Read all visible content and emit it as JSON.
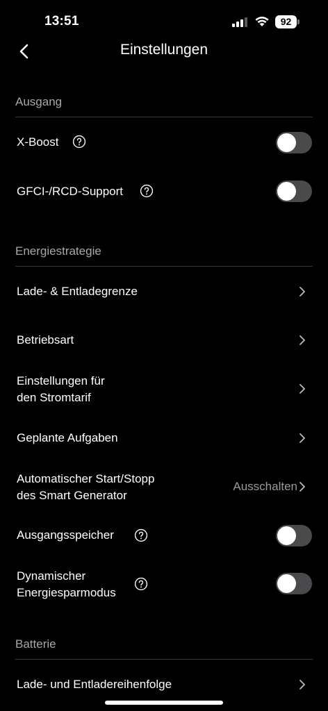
{
  "status_bar": {
    "time": "13:51",
    "battery": "92"
  },
  "header": {
    "title": "Einstellungen"
  },
  "sections": {
    "ausgang": {
      "title": "Ausgang",
      "x_boost": {
        "label": "X-Boost",
        "enabled": false
      },
      "gfci": {
        "label": "GFCI-/RCD-Support",
        "enabled": false
      }
    },
    "energie": {
      "title": "Energiestrategie",
      "lade_grenze": {
        "label": "Lade- & Entladegrenze"
      },
      "betriebsart": {
        "label": "Betriebsart"
      },
      "stromtarif": {
        "label_line1": "Einstellungen für",
        "label_line2": "den Stromtarif"
      },
      "geplante": {
        "label": "Geplante Aufgaben"
      },
      "generator": {
        "label_line1": "Automatischer Start/Stopp",
        "label_line2": "des Smart Generator",
        "value": "Ausschalten"
      },
      "ausgangsspeicher": {
        "label": "Ausgangsspeicher",
        "enabled": false
      },
      "sparmodus": {
        "label_line1": "Dynamischer",
        "label_line2": "Energiesparmodus",
        "enabled": false
      }
    },
    "batterie": {
      "title": "Batterie",
      "reihenfolge": {
        "label": "Lade- und Entladereihenfolge"
      }
    }
  },
  "colors": {
    "background": "#000000",
    "section_title": "#a8a8a8",
    "toggle_off": "#4a4a4c"
  }
}
